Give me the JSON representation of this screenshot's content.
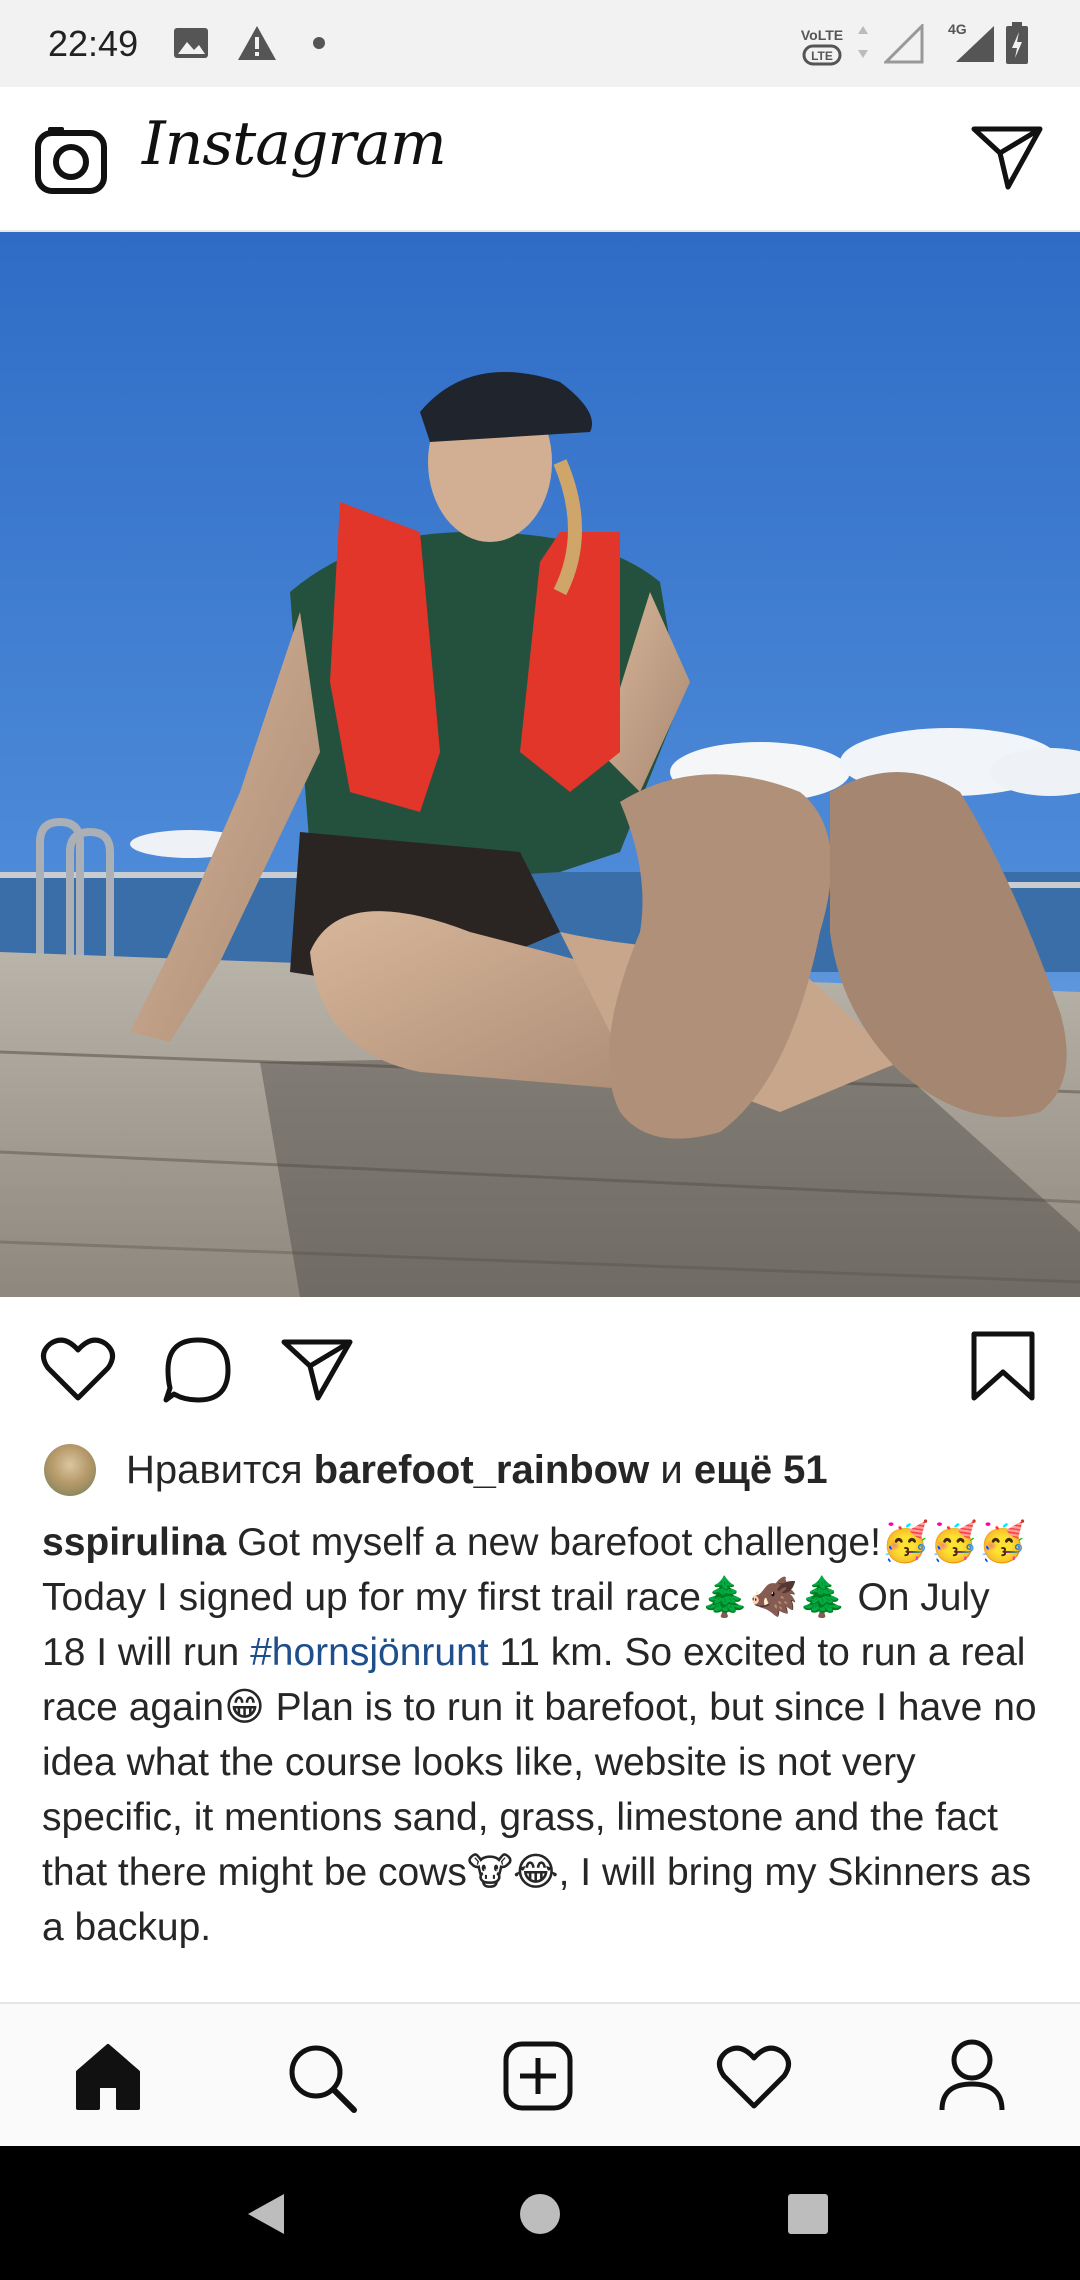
{
  "status_bar": {
    "time": "22:49",
    "icons": [
      "image-icon",
      "warning-icon",
      "dot-icon",
      "volte-icon",
      "signal-icon",
      "4g-signal-icon",
      "battery-icon"
    ]
  },
  "header": {
    "title": "Instagram",
    "icons": [
      "camera-icon",
      "direct-message-icon"
    ]
  },
  "post": {
    "photo_description_icon": "post-photo",
    "actions": [
      "like-icon",
      "comment-icon",
      "share-icon",
      "bookmark-icon"
    ],
    "likes": {
      "prefix": "Нравится",
      "liked_by": "barefoot_rainbow",
      "conjunction": "и",
      "others": "ещё 51"
    },
    "caption": {
      "username": "sspirulina",
      "line1": "Got myself a new barefoot challenge!🥳🥳🥳",
      "text_part1": "Today I signed up for my first trail race🌲🐗🌲 On July 18 I will run ",
      "hashtag": "#hornsjönrunt",
      "text_part2": " 11 km. So excited to run a real race again😁 Plan is to run it barefoot, but since I have no idea what the course looks like, website is not very specific, it mentions sand, grass, limestone and the fact that there might be cows🐮😂, I will bring my Skinners as a backup."
    }
  },
  "bottom_nav": {
    "items": [
      "home-icon",
      "search-icon",
      "new-post-icon",
      "activity-icon",
      "profile-icon"
    ]
  },
  "system_nav": {
    "items": [
      "back-icon",
      "home-circle-icon",
      "recents-icon"
    ]
  },
  "colors": {
    "hashtag": "#1f4e8c",
    "status_bar_bg": "#f2f2f2",
    "system_nav_bg": "#000000"
  }
}
